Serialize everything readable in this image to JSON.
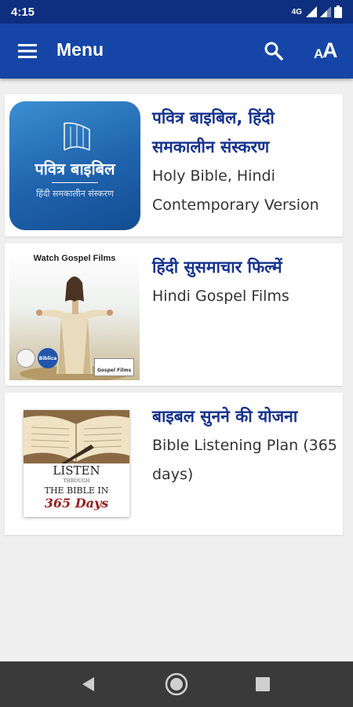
{
  "status_bar": {
    "time": "4:15",
    "network": "4G"
  },
  "app_bar": {
    "title": "Menu",
    "menu_icon": "hamburger-icon",
    "search_icon": "search-icon",
    "font_size_icon": "font-size-icon",
    "font_size_label_small": "A",
    "font_size_label_large": "A"
  },
  "items": [
    {
      "title": "पवित्र बाइबिल, हिंदी समकालीन संस्करण",
      "subtitle": "Holy Bible, Hindi Contemporary Version",
      "thumb": {
        "title": "पवित्र बाइबिल",
        "subtitle": "हिंदी समकालीन संस्करण"
      }
    },
    {
      "title": "हिंदी सुसमाचार फिल्में",
      "subtitle": "Hindi Gospel Films",
      "thumb": {
        "title": "Watch Gospel Films",
        "badge": "Biblica",
        "partner": "Gospel Films"
      }
    },
    {
      "title": "बाइबल सुनने की योजना",
      "subtitle": "Bible Listening Plan (365 days)",
      "thumb": {
        "line1": "LISTEN",
        "line2": "THROUGH",
        "line3": "THE BIBLE IN",
        "line4": "365 Days"
      }
    }
  ],
  "colors": {
    "app_bar": "#1545a7",
    "status_bar": "#0e2f80",
    "title_text": "#17338f",
    "background": "#efefef"
  },
  "nav": {
    "back_icon": "back-triangle-icon",
    "home_icon": "home-circle-icon",
    "recents_icon": "recents-square-icon"
  }
}
